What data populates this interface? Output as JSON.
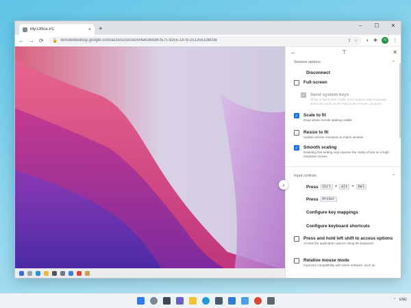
{
  "browser": {
    "tab_title": "My-Office-PC",
    "tab_close": "×",
    "new_tab": "+",
    "url": "remotedesktop.google.com/access/session/4a63e6d4-f57c-9255-187b-c513551d803e",
    "avatar_letter": "N",
    "window_controls": [
      "–",
      "☐",
      "✕"
    ],
    "nav": {
      "back": "←",
      "forward": "→",
      "reload": "⟳"
    }
  },
  "panel": {
    "back": "←",
    "pin": "⊤",
    "close": "✕",
    "toggle": "›",
    "session": {
      "title": "Session options",
      "disconnect": "Disconnect",
      "options": [
        {
          "label": "Full-screen",
          "desc": "",
          "state": "off"
        },
        {
          "label": "Send system keys",
          "desc": "While in full-screen mode, send system-wide keyboard shortcuts (such as Alt+Tab) to the remote computer",
          "state": "disabled"
        },
        {
          "label": "Scale to fit",
          "desc": "Keep whole remote desktop visible",
          "state": "on"
        },
        {
          "label": "Resize to fit",
          "desc": "Update remote resolution to match window",
          "state": "off"
        },
        {
          "label": "Smooth scaling",
          "desc": "Disabling this setting may improve the clarity of text on a high-resolution screen",
          "state": "on"
        }
      ]
    },
    "input": {
      "title": "Input controls",
      "press1_prefix": "Press",
      "press1_keys": [
        "Ctrl",
        "Alt",
        "Del"
      ],
      "press2_prefix": "Press",
      "press2_key": "PrtScr",
      "plus": "+",
      "key_mappings": "Configure key mappings",
      "keyboard_shortcuts": "Configure keyboard shortcuts",
      "options": [
        {
          "label": "Press and hold left shift to access options",
          "desc": "Access the application options using the keyboard",
          "state": "off"
        },
        {
          "label": "Relative mouse mode",
          "desc": "Improves compatibility with some software, such as",
          "state": "off"
        }
      ]
    }
  },
  "system": {
    "tray_lang": "ENG"
  },
  "colors": {
    "accent": "#1a73e8",
    "desktop_bg": "#5fc4e6"
  }
}
